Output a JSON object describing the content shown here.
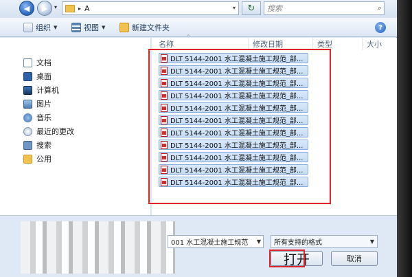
{
  "address": {
    "crumb_sep": "▸",
    "folder": "A",
    "dropdown": "▾"
  },
  "nav_buttons": {
    "back": "◀",
    "forward": "▶",
    "refresh": "↻"
  },
  "search": {
    "placeholder": "搜索"
  },
  "toolbar": {
    "organize": "组织",
    "views": "视图",
    "new_folder": "新建文件夹",
    "help": "?"
  },
  "sidebar": {
    "items": [
      {
        "label": "文档",
        "icon": "documents-icon"
      },
      {
        "label": "桌面",
        "icon": "desktop-icon"
      },
      {
        "label": "计算机",
        "icon": "computer-icon"
      },
      {
        "label": "图片",
        "icon": "pictures-icon"
      },
      {
        "label": "音乐",
        "icon": "music-icon"
      },
      {
        "label": "最近的更改",
        "icon": "recent-icon"
      },
      {
        "label": "搜索",
        "icon": "search-folder-icon"
      },
      {
        "label": "公用",
        "icon": "public-folder-icon"
      }
    ]
  },
  "columns": {
    "name": "名称",
    "date": "修改日期",
    "type": "类型",
    "size": "大小"
  },
  "files": [
    "DLT 5144-2001 水工混凝土施工规范_部...",
    "DLT 5144-2001 水工混凝土施工规范_部...",
    "DLT 5144-2001 水工混凝土施工规范_部...",
    "DLT 5144-2001 水工混凝土施工规范_部...",
    "DLT 5144-2001 水工混凝土施工规范_部...",
    "DLT 5144-2001 水工混凝土施工规范_部...",
    "DLT 5144-2001 水工混凝土施工规范_部...",
    "DLT 5144-2001 水工混凝土施工规范_部...",
    "DLT 5144-2001 水工混凝土施工规范_部...",
    "DLT 5144-2001 水工混凝土施工规范_部...",
    "DLT 5144-2001 水工混凝土施工规范_部..."
  ],
  "footer": {
    "filename": "001 水工混凝土施工规范",
    "filter": "所有支持的格式",
    "open_label": "打开",
    "cancel_label": "取消"
  },
  "colors": {
    "highlight_box": "#e0222a",
    "selection": "#c5dcf6"
  }
}
